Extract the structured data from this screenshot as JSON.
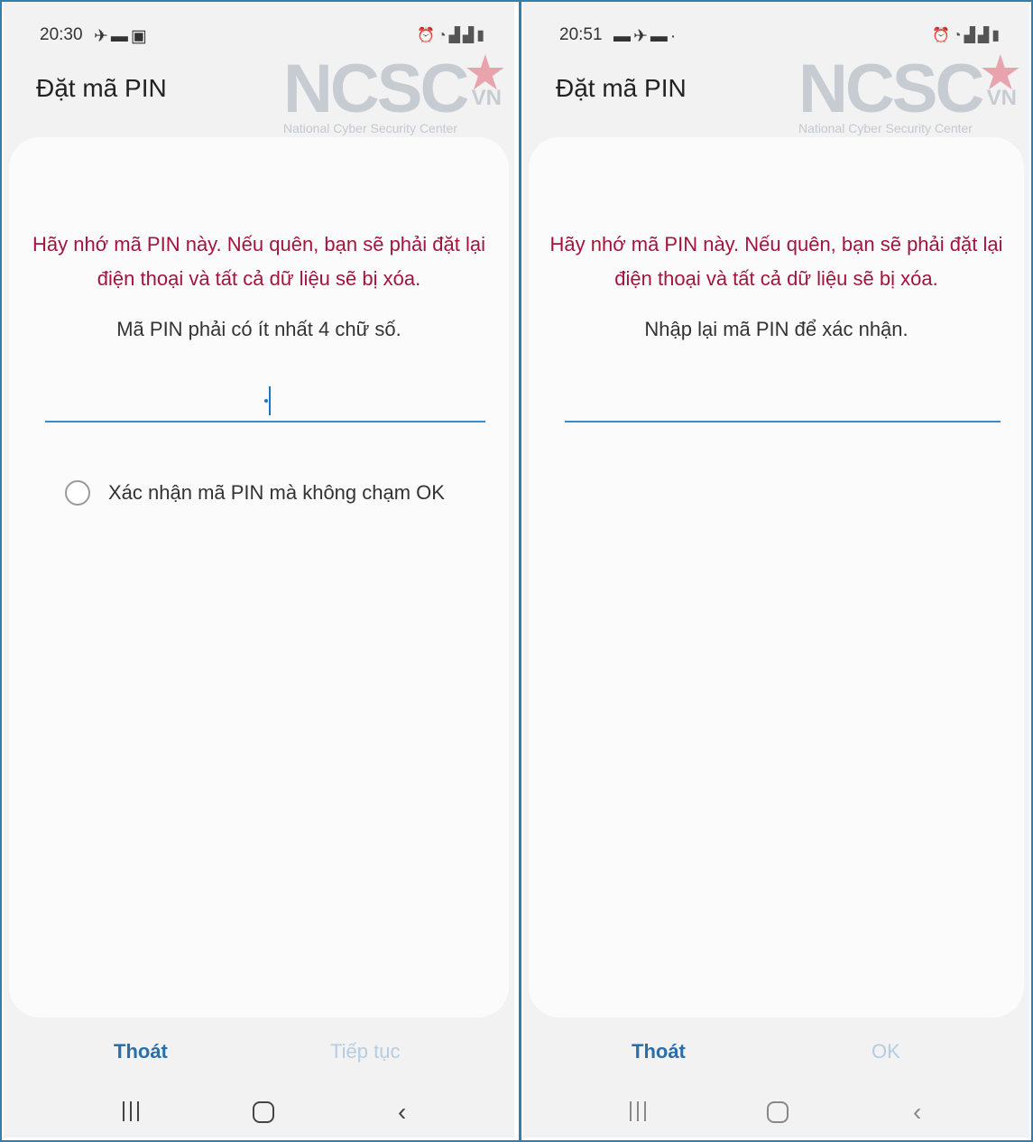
{
  "screens": [
    {
      "status": {
        "time": "20:30"
      },
      "title": "Đặt mã PIN",
      "warning": "Hãy nhớ mã PIN này. Nếu quên, bạn sẽ phải đặt lại điện thoại và tất cả dữ liệu sẽ bị xóa.",
      "hint": "Mã PIN phải có ít nhất 4 chữ số.",
      "pin_value": "",
      "checkbox_label": "Xác nhận mã PIN mà không chạm OK",
      "buttons": {
        "exit": "Thoát",
        "next": "Tiếp tục"
      }
    },
    {
      "status": {
        "time": "20:51"
      },
      "title": "Đặt mã PIN",
      "warning": "Hãy nhớ mã PIN này. Nếu quên, bạn sẽ phải đặt lại điện thoại và tất cả dữ liệu sẽ bị xóa.",
      "hint": "Nhập lại mã PIN để xác nhận.",
      "pin_value": "",
      "buttons": {
        "exit": "Thoát",
        "next": "OK"
      }
    }
  ],
  "watermark": {
    "logo": "NCSC",
    "suffix": "VN",
    "subtitle": "National Cyber Security Center"
  },
  "icons": {
    "status_left": [
      "signal-icon",
      "message-icon",
      "calendar-icon"
    ],
    "status_right": [
      "alarm-icon",
      "wifi-icon",
      "cell-signal-icon",
      "battery-icon"
    ],
    "nav": [
      "recent-apps-icon",
      "home-icon",
      "back-icon"
    ]
  },
  "colors": {
    "warning_text": "#a3143d",
    "accent": "#2c6ea6",
    "input_underline": "#3f8ac4",
    "disabled_button": "#b6cce0",
    "frame_border": "#2f7fb5"
  }
}
